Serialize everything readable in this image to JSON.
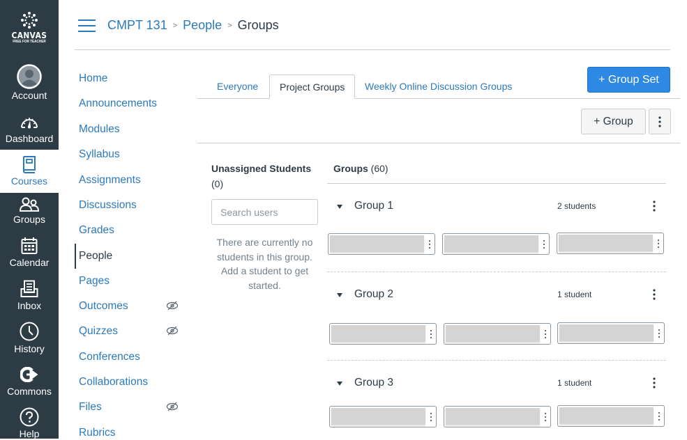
{
  "global_nav": {
    "logo": {
      "line1": "CANVAS",
      "line2": "FREE FOR TEACHER",
      "icon": "canvas-logo-icon"
    },
    "items": [
      {
        "label": "Account",
        "icon": "avatar-icon",
        "active": false
      },
      {
        "label": "Dashboard",
        "icon": "speedometer-icon",
        "active": false
      },
      {
        "label": "Courses",
        "icon": "book-icon",
        "active": true
      },
      {
        "label": "Groups",
        "icon": "users-icon",
        "active": false
      },
      {
        "label": "Calendar",
        "icon": "calendar-icon",
        "active": false
      },
      {
        "label": "Inbox",
        "icon": "inbox-icon",
        "active": false
      },
      {
        "label": "History",
        "icon": "clock-icon",
        "active": false
      },
      {
        "label": "Commons",
        "icon": "commons-icon",
        "active": false
      },
      {
        "label": "Help",
        "icon": "help-icon",
        "active": false
      }
    ]
  },
  "breadcrumb": {
    "items": [
      "CMPT 131",
      "People",
      "Groups"
    ],
    "separator": ">"
  },
  "course_nav": {
    "items": [
      {
        "label": "Home",
        "hidden": false,
        "active": false
      },
      {
        "label": "Announcements",
        "hidden": false,
        "active": false
      },
      {
        "label": "Modules",
        "hidden": false,
        "active": false
      },
      {
        "label": "Syllabus",
        "hidden": false,
        "active": false
      },
      {
        "label": "Assignments",
        "hidden": false,
        "active": false
      },
      {
        "label": "Discussions",
        "hidden": false,
        "active": false
      },
      {
        "label": "Grades",
        "hidden": false,
        "active": false
      },
      {
        "label": "People",
        "hidden": false,
        "active": true
      },
      {
        "label": "Pages",
        "hidden": false,
        "active": false
      },
      {
        "label": "Outcomes",
        "hidden": true,
        "active": false
      },
      {
        "label": "Quizzes",
        "hidden": true,
        "active": false
      },
      {
        "label": "Conferences",
        "hidden": false,
        "active": false
      },
      {
        "label": "Collaborations",
        "hidden": false,
        "active": false
      },
      {
        "label": "Files",
        "hidden": true,
        "active": false
      },
      {
        "label": "Rubrics",
        "hidden": false,
        "active": false
      }
    ]
  },
  "tabs": [
    {
      "label": "Everyone",
      "active": false
    },
    {
      "label": "Project Groups",
      "active": true
    },
    {
      "label": "Weekly Online Discussion Groups",
      "active": false
    }
  ],
  "buttons": {
    "group_set": "+ Group Set",
    "group": "+ Group"
  },
  "unassigned": {
    "title": "Unassigned Students",
    "count": "(0)",
    "search_placeholder": "Search users",
    "empty_message": "There are currently no students in this group. Add a student to get started."
  },
  "groups": {
    "title": "Groups",
    "count": "(60)",
    "list": [
      {
        "name": "Group 1",
        "count_label": "2 students",
        "student_slots": 3
      },
      {
        "name": "Group 2",
        "count_label": "1 student",
        "student_slots": 3
      },
      {
        "name": "Group 3",
        "count_label": "1 student",
        "student_slots": 3
      }
    ]
  },
  "colors": {
    "nav_bg": "#2d3b45",
    "link": "#2b7abc",
    "primary_button": "#2d89e3",
    "text": "#2d3b45",
    "muted": "#73818c",
    "border": "#c7cdd1"
  }
}
